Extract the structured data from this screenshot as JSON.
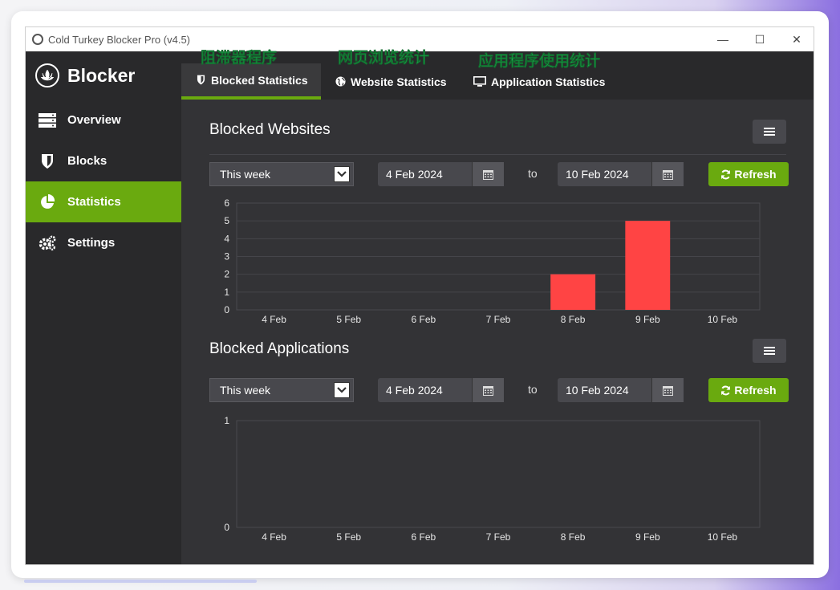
{
  "window": {
    "title": "Cold Turkey Blocker Pro (v4.5)",
    "controls": {
      "minimize": "—",
      "maximize": "☐",
      "close": "✕"
    }
  },
  "sidebar": {
    "brand": "Blocker",
    "items": [
      {
        "label": "Overview",
        "icon": "server-icon",
        "active": false
      },
      {
        "label": "Blocks",
        "icon": "shield-icon",
        "active": false
      },
      {
        "label": "Statistics",
        "icon": "pie-chart-icon",
        "active": true
      },
      {
        "label": "Settings",
        "icon": "gears-icon",
        "active": false
      }
    ]
  },
  "tabs": [
    {
      "label": "Blocked Statistics",
      "icon": "shield-icon",
      "active": true,
      "annotation": "阻滞器程序"
    },
    {
      "label": "Website Statistics",
      "icon": "globe-icon",
      "active": false,
      "annotation": "网页浏览统计"
    },
    {
      "label": "Application Statistics",
      "icon": "monitor-icon",
      "active": false,
      "annotation": "应用程序使用统计"
    }
  ],
  "websites": {
    "title": "Blocked Websites",
    "range": "This week",
    "from": "4 Feb 2024",
    "to_label": "to",
    "to": "10 Feb 2024",
    "refresh": "Refresh"
  },
  "applications": {
    "title": "Blocked Applications",
    "range": "This week",
    "from": "4 Feb 2024",
    "to_label": "to",
    "to": "10 Feb 2024",
    "refresh": "Refresh"
  },
  "colors": {
    "accent": "#6aaa0f",
    "bar": "#ff4444",
    "annotation": "#22c55e"
  },
  "chart_data": [
    {
      "type": "bar",
      "categories": [
        "4 Feb",
        "5 Feb",
        "6 Feb",
        "7 Feb",
        "8 Feb",
        "9 Feb",
        "10 Feb"
      ],
      "values": [
        0,
        0,
        0,
        0,
        2,
        5,
        0
      ],
      "yticks": [
        0,
        1,
        2,
        3,
        4,
        5,
        6
      ],
      "ylim": [
        0,
        6
      ],
      "grid": true
    },
    {
      "type": "bar",
      "categories": [
        "4 Feb",
        "5 Feb",
        "6 Feb",
        "7 Feb",
        "8 Feb",
        "9 Feb",
        "10 Feb"
      ],
      "values": [
        0,
        0,
        0,
        0,
        0,
        0,
        0
      ],
      "yticks": [
        0,
        1
      ],
      "ylim": [
        0,
        1
      ],
      "grid": false
    }
  ]
}
